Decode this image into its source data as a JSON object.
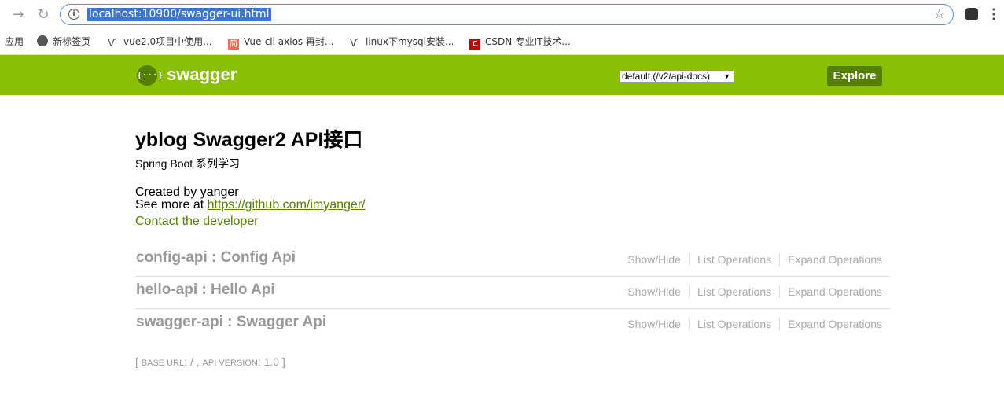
{
  "browser": {
    "url": "localhost:10900/swagger-ui.html",
    "back_icon": "arrow-right-icon",
    "reload_icon": "reload-icon",
    "bookmarks": [
      {
        "label": "应用",
        "icon": "apps-icon"
      },
      {
        "label": "新标签页",
        "icon": "globe-icon"
      },
      {
        "label": "vue2.0项目中使用...",
        "icon": "vue-icon"
      },
      {
        "label": "Vue-cli axios 再封...",
        "icon": "jianshu-icon"
      },
      {
        "label": "linux下mysql安装...",
        "icon": "vue-icon"
      },
      {
        "label": "CSDN-专业IT技术...",
        "icon": "csdn-icon"
      }
    ]
  },
  "header": {
    "logo_text": "{···}",
    "title": "swagger",
    "spec_select": "default (/v2/api-docs)",
    "explore_label": "Explore",
    "bg_color": "#89bf04"
  },
  "info": {
    "title": "yblog Swagger2 API接口",
    "description": "Spring Boot 系列学习",
    "created_by": "Created by yanger",
    "see_more_prefix": "See more at ",
    "see_more_link": "https://github.com/imyanger/",
    "contact": "Contact the developer"
  },
  "resources": [
    {
      "name": "config-api : Config Api"
    },
    {
      "name": "hello-api : Hello Api"
    },
    {
      "name": "swagger-api : Swagger Api"
    }
  ],
  "resource_ops": {
    "show_hide": "Show/Hide",
    "list": "List Operations",
    "expand": "Expand Operations"
  },
  "footer": {
    "open": "[ ",
    "base_url_label": "base url",
    "base_url_value": ": / , ",
    "api_version_label": "api version",
    "api_version_value": ": 1.0 ]"
  }
}
